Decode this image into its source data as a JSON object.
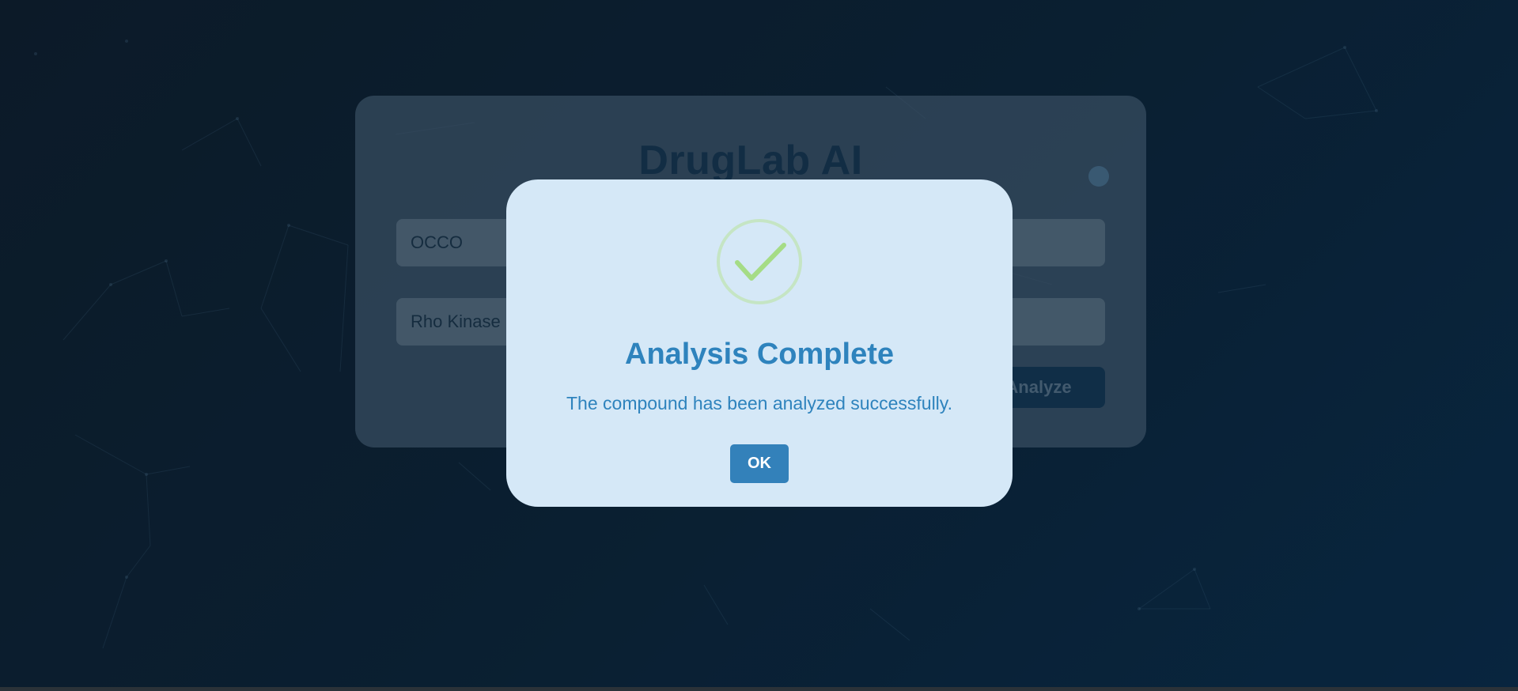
{
  "app": {
    "title": "DrugLab AI"
  },
  "form": {
    "smiles_value": "OCCO",
    "target_value": "Rho Kinase",
    "analyze_label": "Analyze"
  },
  "modal": {
    "icon": "checkmark-icon",
    "title": "Analysis Complete",
    "message": "The compound has been analyzed successfully.",
    "ok_label": "OK"
  },
  "colors": {
    "accent": "#3381ba",
    "success": "#a5dc86",
    "modal_background": "#d5e8f7",
    "page_background": "#0c2336"
  }
}
